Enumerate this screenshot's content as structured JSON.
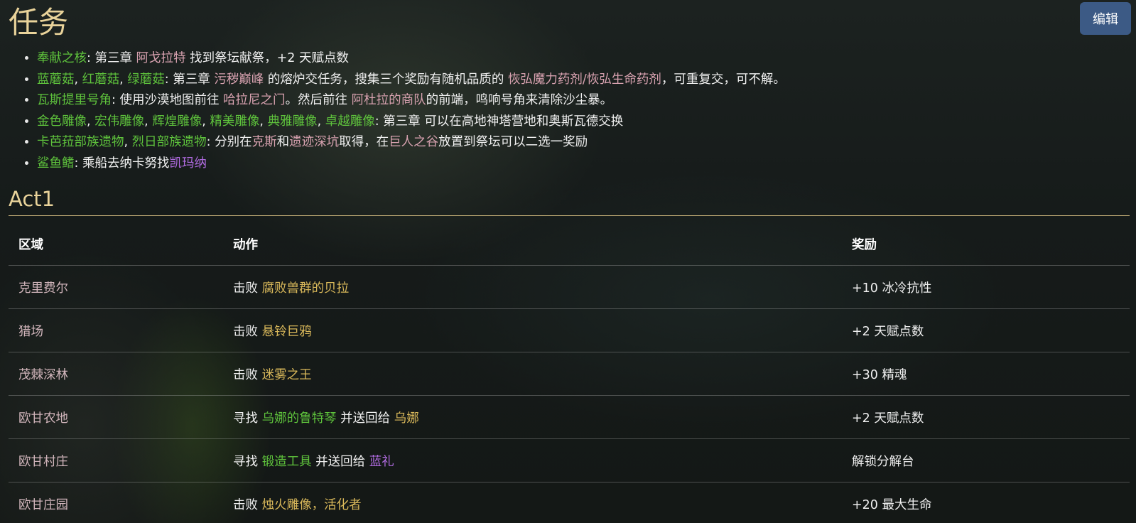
{
  "page": {
    "title": "任务",
    "edit_label": "编辑"
  },
  "quests": [
    {
      "parts": [
        {
          "text": "奉献之核",
          "color": "green"
        },
        {
          "text": ": 第三章 ",
          "color": "white"
        },
        {
          "text": "阿戈拉特",
          "color": "pink"
        },
        {
          "text": " 找到祭坛献祭，+2 天赋点数",
          "color": "white"
        }
      ]
    },
    {
      "parts": [
        {
          "text": "蓝蘑菇",
          "color": "green"
        },
        {
          "text": ", ",
          "color": "white"
        },
        {
          "text": "红蘑菇",
          "color": "green"
        },
        {
          "text": ", ",
          "color": "white"
        },
        {
          "text": "绿蘑菇",
          "color": "green"
        },
        {
          "text": ": 第三章 ",
          "color": "white"
        },
        {
          "text": "污秽巅峰",
          "color": "pink"
        },
        {
          "text": " 的熔炉交任务，搜集三个奖励有随机品质的 ",
          "color": "white"
        },
        {
          "text": "恢弘魔力药剂/恢弘生命药剂",
          "color": "pink"
        },
        {
          "text": "，可重复交，可不解。",
          "color": "white"
        }
      ]
    },
    {
      "parts": [
        {
          "text": "瓦斯提里号角",
          "color": "green"
        },
        {
          "text": ": 使用沙漠地图前往 ",
          "color": "white"
        },
        {
          "text": "哈拉尼之门",
          "color": "pink"
        },
        {
          "text": "。然后前往 ",
          "color": "white"
        },
        {
          "text": "阿杜拉的商队",
          "color": "pink"
        },
        {
          "text": "的前端，鸣响号角来清除沙尘暴。",
          "color": "white"
        }
      ]
    },
    {
      "parts": [
        {
          "text": "金色雕像",
          "color": "green"
        },
        {
          "text": ", ",
          "color": "white"
        },
        {
          "text": "宏伟雕像",
          "color": "green"
        },
        {
          "text": ", ",
          "color": "white"
        },
        {
          "text": "辉煌雕像",
          "color": "green"
        },
        {
          "text": ", ",
          "color": "white"
        },
        {
          "text": "精美雕像",
          "color": "green"
        },
        {
          "text": ", ",
          "color": "white"
        },
        {
          "text": "典雅雕像",
          "color": "green"
        },
        {
          "text": ", ",
          "color": "white"
        },
        {
          "text": "卓越雕像",
          "color": "green"
        },
        {
          "text": ": 第三章 可以在高地神塔营地和奥斯瓦德交换",
          "color": "white"
        }
      ]
    },
    {
      "parts": [
        {
          "text": "卡芭菈部族遗物",
          "color": "green"
        },
        {
          "text": ", ",
          "color": "white"
        },
        {
          "text": "烈日部族遗物",
          "color": "green"
        },
        {
          "text": ": 分别在",
          "color": "white"
        },
        {
          "text": "克斯",
          "color": "pink"
        },
        {
          "text": "和",
          "color": "white"
        },
        {
          "text": "遗迹深坑",
          "color": "pink"
        },
        {
          "text": "取得，在",
          "color": "white"
        },
        {
          "text": "巨人之谷",
          "color": "pink"
        },
        {
          "text": "放置到祭坛可以二选一奖励",
          "color": "white"
        }
      ]
    },
    {
      "parts": [
        {
          "text": "鲨鱼鳍",
          "color": "green"
        },
        {
          "text": ": 乘船去纳卡努找",
          "color": "white"
        },
        {
          "text": "凯玛纳",
          "color": "purple"
        }
      ]
    }
  ],
  "act1": {
    "title": "Act1",
    "headers": {
      "area": "区域",
      "action": "动作",
      "reward": "奖励"
    },
    "rows": [
      {
        "area": "克里费尔",
        "action": [
          {
            "text": "击败 ",
            "color": "white"
          },
          {
            "text": "腐败兽群的贝拉",
            "color": "gold"
          }
        ],
        "reward": "+10 冰冷抗性"
      },
      {
        "area": "猎场",
        "action": [
          {
            "text": "击败 ",
            "color": "white"
          },
          {
            "text": "悬铃巨鸦",
            "color": "gold"
          }
        ],
        "reward": "+2 天赋点数"
      },
      {
        "area": "茂棘深林",
        "action": [
          {
            "text": "击败 ",
            "color": "white"
          },
          {
            "text": "迷雾之王",
            "color": "gold"
          }
        ],
        "reward": "+30 精魂"
      },
      {
        "area": "欧甘农地",
        "action": [
          {
            "text": "寻找 ",
            "color": "white"
          },
          {
            "text": "乌娜的鲁特琴",
            "color": "green"
          },
          {
            "text": " 并送回给 ",
            "color": "white"
          },
          {
            "text": "乌娜",
            "color": "gold"
          }
        ],
        "reward": "+2 天赋点数"
      },
      {
        "area": "欧甘村庄",
        "action": [
          {
            "text": "寻找 ",
            "color": "white"
          },
          {
            "text": "锻造工具",
            "color": "green"
          },
          {
            "text": " 并送回给 ",
            "color": "white"
          },
          {
            "text": "蓝礼",
            "color": "purple"
          }
        ],
        "reward": "解锁分解台"
      },
      {
        "area": "欧甘庄园",
        "action": [
          {
            "text": "击败 ",
            "color": "white"
          },
          {
            "text": "烛火雕像，活化者",
            "color": "gold"
          }
        ],
        "reward": "+20 最大生命"
      }
    ]
  },
  "colors": {
    "title": "#e9d39a",
    "green": "#5ec23c",
    "gold": "#d9b85a",
    "pink": "#d8a2b0",
    "purple": "#b06be0",
    "button_bg": "#3c5a85"
  }
}
